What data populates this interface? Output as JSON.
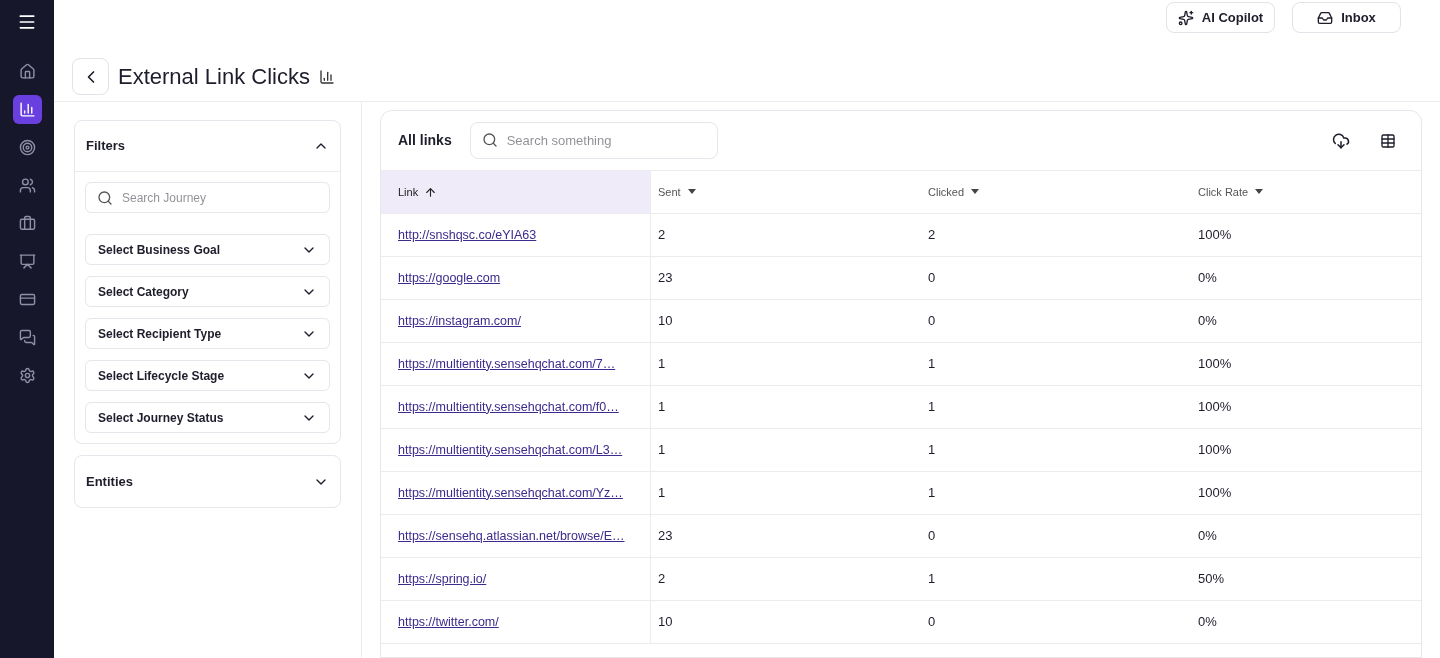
{
  "nav": {
    "items": [
      {
        "kind": "home",
        "selected": false
      },
      {
        "kind": "analytics",
        "selected": true
      },
      {
        "kind": "target",
        "selected": false
      },
      {
        "kind": "people",
        "selected": false
      },
      {
        "kind": "briefcase",
        "selected": false
      },
      {
        "kind": "board",
        "selected": false
      },
      {
        "kind": "card",
        "selected": false
      },
      {
        "kind": "chat",
        "selected": false
      },
      {
        "kind": "settings",
        "selected": false
      }
    ]
  },
  "top_buttons": [
    {
      "kind": "sparkle",
      "label": "AI Copilot"
    },
    {
      "kind": "inbox",
      "label": "Inbox"
    }
  ],
  "page": {
    "title": "External Link Clicks"
  },
  "filters": [
    {
      "title": "Filters",
      "expanded": true,
      "search": {
        "placeholder": "Search Journey"
      },
      "selects": [
        "Select Business Goal",
        "Select Category",
        "Select Recipient Type",
        "Select Lifecycle Stage",
        "Select Journey Status"
      ]
    },
    {
      "title": "Entities",
      "expanded": false
    }
  ],
  "table": {
    "title": "All links",
    "search": {
      "placeholder": "Search something"
    },
    "columns": [
      {
        "label": "Link",
        "sorted": true
      },
      {
        "label": "Sent",
        "sorted": false
      },
      {
        "label": "Clicked",
        "sorted": false
      },
      {
        "label": "Click Rate",
        "sorted": false
      }
    ],
    "rows": [
      [
        "http://snshqsc.co/eYIA63",
        "2",
        "2",
        "100%"
      ],
      [
        "https://google.com",
        "23",
        "0",
        "0%"
      ],
      [
        "https://instagram.com/",
        "10",
        "0",
        "0%"
      ],
      [
        "https://multientity.sensehqchat.com/7…",
        "1",
        "1",
        "100%"
      ],
      [
        "https://multientity.sensehqchat.com/f0…",
        "1",
        "1",
        "100%"
      ],
      [
        "https://multientity.sensehqchat.com/L3…",
        "1",
        "1",
        "100%"
      ],
      [
        "https://multientity.sensehqchat.com/Yz…",
        "1",
        "1",
        "100%"
      ],
      [
        "https://sensehq.atlassian.net/browse/E…",
        "23",
        "0",
        "0%"
      ],
      [
        "https://spring.io/",
        "2",
        "1",
        "50%"
      ],
      [
        "https://twitter.com/",
        "10",
        "0",
        "0%"
      ]
    ]
  }
}
